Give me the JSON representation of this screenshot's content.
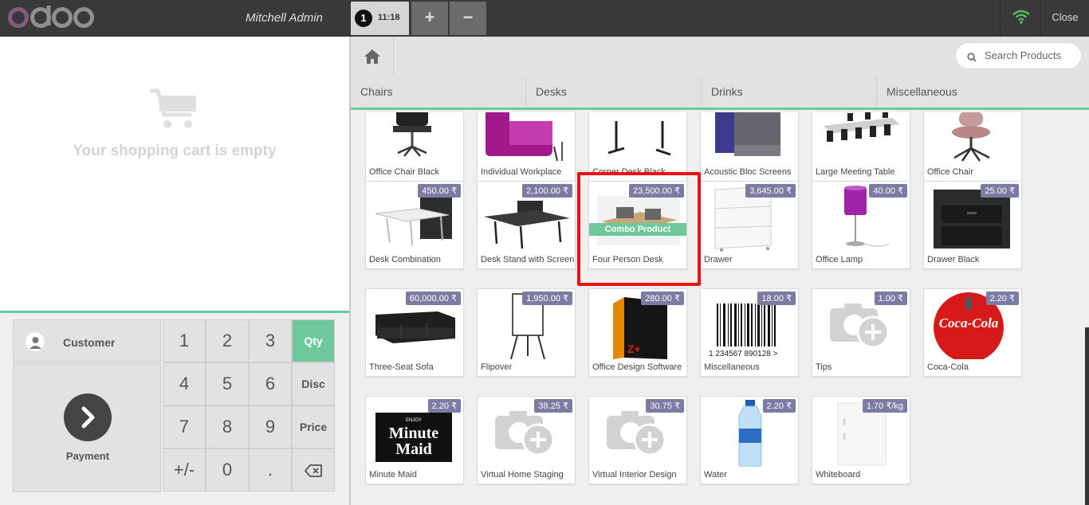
{
  "header": {
    "logo_text": "odoo",
    "user_name": "Mitchell Admin",
    "order": {
      "number": "1",
      "time": "11:18"
    },
    "add_order_label": "+",
    "remove_order_label": "−",
    "close_label": "Close",
    "wifi_color": "#5cb85c"
  },
  "cart": {
    "empty_message": "Your shopping cart is empty"
  },
  "actionpad": {
    "customer_label": "Customer",
    "payment_label": "Payment"
  },
  "numpad": {
    "keys": [
      "1",
      "2",
      "3",
      "Qty",
      "4",
      "5",
      "6",
      "Disc",
      "7",
      "8",
      "9",
      "Price",
      "+/-",
      "0",
      ".",
      "⌫"
    ],
    "active_mode": "Qty",
    "accent_color": "#6ec89b"
  },
  "search": {
    "placeholder": "Search Products"
  },
  "categories": [
    "Chairs",
    "Desks",
    "Drinks",
    "Miscellaneous"
  ],
  "products": [
    {
      "name": "Office Chair Black",
      "price": ""
    },
    {
      "name": "Individual Workplace",
      "price": ""
    },
    {
      "name": "Corner Desk Black",
      "price": ""
    },
    {
      "name": "Acoustic Bloc Screens",
      "price": ""
    },
    {
      "name": "Large Meeting Table",
      "price": ""
    },
    {
      "name": "Office Chair",
      "price": ""
    },
    {
      "name": "Desk Combination",
      "price": "450.00 ₹"
    },
    {
      "name": "Desk Stand with Screen",
      "price": "2,100.00 ₹"
    },
    {
      "name": "Four Person Desk",
      "price": "23,500.00 ₹",
      "badge": "Combo Product"
    },
    {
      "name": "Drawer",
      "price": "3,645.00 ₹"
    },
    {
      "name": "Office Lamp",
      "price": "40.00 ₹"
    },
    {
      "name": "Drawer Black",
      "price": "25.00 ₹"
    },
    {
      "name": "Three-Seat Sofa",
      "price": "60,000.00 ₹"
    },
    {
      "name": "Flipover",
      "price": "1,950.00 ₹"
    },
    {
      "name": "Office Design Software",
      "price": "280.00 ₹"
    },
    {
      "name": "Miscellaneous",
      "price": "18.00 ₹"
    },
    {
      "name": "Tips",
      "price": "1.00 ₹"
    },
    {
      "name": "Coca-Cola",
      "price": "2.20 ₹"
    },
    {
      "name": "Minute Maid",
      "price": "2.20 ₹"
    },
    {
      "name": "Virtual Home Staging",
      "price": "38.25 ₹"
    },
    {
      "name": "Virtual Interior Design",
      "price": "30.75 ₹"
    },
    {
      "name": "Water",
      "price": "2.20 ₹"
    },
    {
      "name": "Whiteboard",
      "price": "1.70 ₹/kg"
    }
  ],
  "image_text": {
    "barcode_digits": "1 234567 890128 >",
    "software_box": "Z+",
    "coca_cola": "Coca-Cola",
    "minute_maid_top": "ENJOY",
    "minute_maid_1": "Minute",
    "minute_maid_2": "Maid"
  }
}
